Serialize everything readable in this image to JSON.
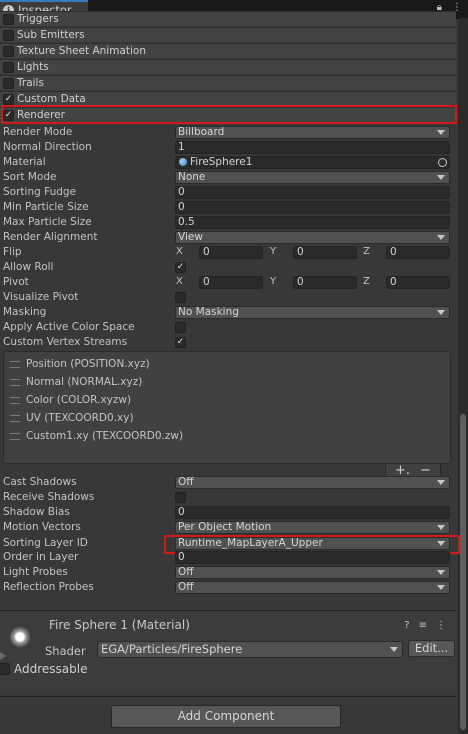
{
  "window": {
    "tab_title": "Inspector"
  },
  "modules": [
    {
      "label": "Triggers",
      "checked": false
    },
    {
      "label": "Sub Emitters",
      "checked": false
    },
    {
      "label": "Texture Sheet Animation",
      "checked": false
    },
    {
      "label": "Lights",
      "checked": false
    },
    {
      "label": "Trails",
      "checked": false
    },
    {
      "label": "Custom Data",
      "checked": true
    },
    {
      "label": "Renderer",
      "checked": true
    }
  ],
  "renderer": {
    "render_mode": {
      "label": "Render Mode",
      "value": "Billboard"
    },
    "normal_direction": {
      "label": "Normal Direction",
      "value": "1"
    },
    "material": {
      "label": "Material",
      "value": "FireSphere1"
    },
    "sort_mode": {
      "label": "Sort Mode",
      "value": "None"
    },
    "sorting_fudge": {
      "label": "Sorting Fudge",
      "value": "0"
    },
    "min_particle_size": {
      "label": "Min Particle Size",
      "value": "0"
    },
    "max_particle_size": {
      "label": "Max Particle Size",
      "value": "0.5"
    },
    "render_alignment": {
      "label": "Render Alignment",
      "value": "View"
    },
    "flip": {
      "label": "Flip",
      "x": "0",
      "y": "0",
      "z": "0"
    },
    "allow_roll": {
      "label": "Allow Roll",
      "checked": true
    },
    "pivot": {
      "label": "Pivot",
      "x": "0",
      "y": "0",
      "z": "0"
    },
    "visualize_pivot": {
      "label": "Visualize Pivot",
      "checked": false
    },
    "masking": {
      "label": "Masking",
      "value": "No Masking"
    },
    "apply_active_color_space": {
      "label": "Apply Active Color Space",
      "checked": false
    },
    "custom_vertex_streams": {
      "label": "Custom Vertex Streams",
      "checked": true
    },
    "streams": [
      "Position (POSITION.xyz)",
      "Normal (NORMAL.xyz)",
      "Color (COLOR.xyzw)",
      "UV (TEXCOORD0.xy)",
      "Custom1.xy (TEXCOORD0.zw)"
    ],
    "cast_shadows": {
      "label": "Cast Shadows",
      "value": "Off"
    },
    "receive_shadows": {
      "label": "Receive Shadows",
      "checked": false
    },
    "shadow_bias": {
      "label": "Shadow Bias",
      "value": "0"
    },
    "motion_vectors": {
      "label": "Motion Vectors",
      "value": "Per Object Motion"
    },
    "sorting_layer_id": {
      "label": "Sorting Layer ID",
      "value": "Runtime_MapLayerA_Upper"
    },
    "order_in_layer": {
      "label": "Order in Layer",
      "value": "0"
    },
    "light_probes": {
      "label": "Light Probes",
      "value": "Off"
    },
    "reflection_probes": {
      "label": "Reflection Probes",
      "value": "Off"
    }
  },
  "axes": {
    "x": "X",
    "y": "Y",
    "z": "Z"
  },
  "material_panel": {
    "title": "Fire Sphere 1 (Material)",
    "shader_label": "Shader",
    "shader_value": "EGA/Particles/FireSphere",
    "edit_label": "Edit...",
    "addressable_label": "Addressable",
    "addressable_checked": false
  },
  "add_component_label": "Add Component",
  "colors": {
    "highlight": "#d21a1a",
    "background": "#383838",
    "tab_accent": "#3a79bb"
  }
}
